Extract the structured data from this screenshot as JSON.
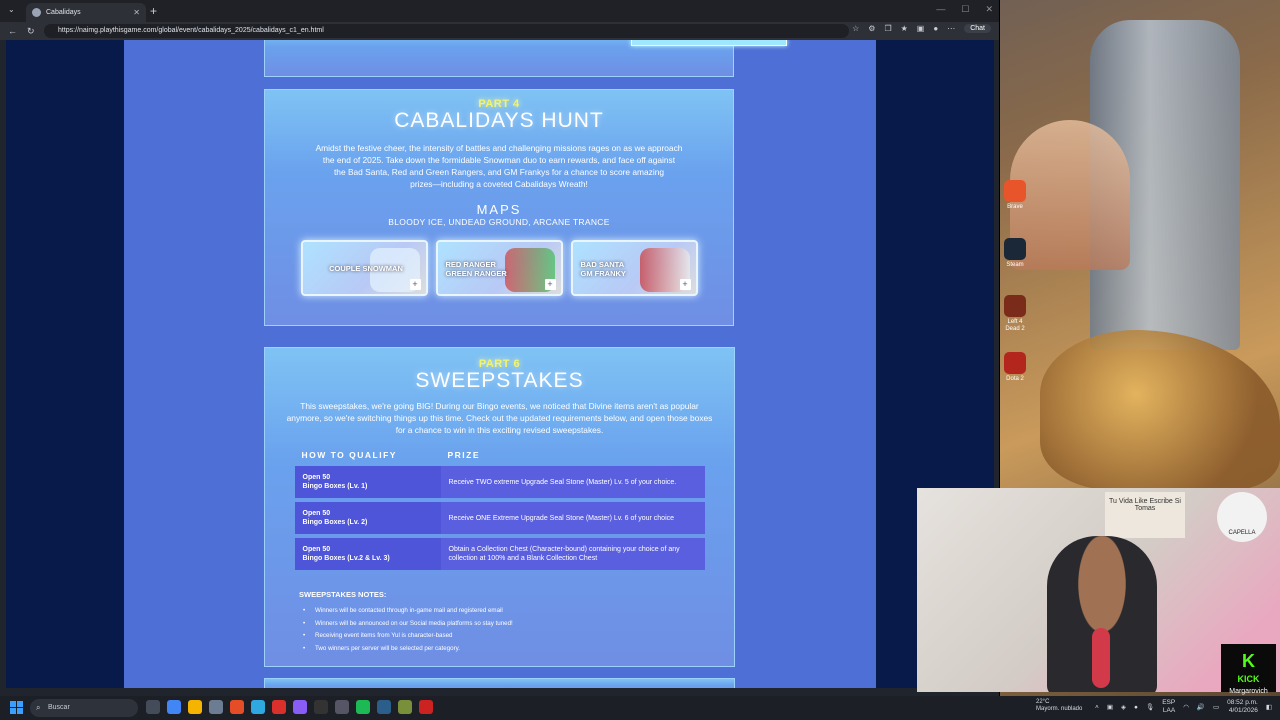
{
  "browser": {
    "tab_title": "Cabalidays",
    "url": "https://naimg.playthisgame.com/global/event/cabalidays_2025/cabalidays_c1_en.html",
    "chat_label": "Chat"
  },
  "part4": {
    "part_label": "PART 4",
    "title": "CABALIDAYS HUNT",
    "description_lines": [
      "Amidst the festive cheer, the intensity of battles and challenging missions rages on as we approach",
      "the end of 2025. Take down the formidable Snowman duo to earn rewards, and face off against",
      "the Bad Santa, Red and Green Rangers, and GM Frankys for a chance to score amazing",
      "prizes—including a coveted Cabalidays Wreath!"
    ],
    "maps_title": "MAPS",
    "maps_list": "BLOODY ICE, UNDEAD GROUND, ARCANE TRANCE",
    "map_cards": [
      {
        "line1": "COUPLE SNOWMAN",
        "line2": "",
        "plus": "+"
      },
      {
        "line1": "RED RANGER",
        "line2": "GREEN RANGER",
        "plus": "+"
      },
      {
        "line1": "BAD SANTA",
        "line2": "GM FRANKY",
        "plus": "+"
      }
    ]
  },
  "part6": {
    "part_label": "PART 6",
    "title": "SWEEPSTAKES",
    "description_lines": [
      "This sweepstakes, we're going BIG! During our Bingo events, we noticed that Divine items aren't as popular",
      "anymore, so we're switching things up this time. Check out the updated requirements below, and open those boxes",
      "for a chance to win in this exciting revised sweepstakes."
    ],
    "headers": {
      "qualify": "HOW TO QUALIFY",
      "prize": "PRIZE"
    },
    "rows": [
      {
        "q1": "Open 50",
        "q2": "Bingo Boxes (Lv. 1)",
        "prize1": "Receive TWO extreme Upgrade Seal Stone (Master) Lv. 5 of your choice.",
        "prize2": ""
      },
      {
        "q1": "Open 50",
        "q2": "Bingo Boxes (Lv. 2)",
        "prize1": "Receive ONE Extreme Upgrade Seal Stone (Master) Lv. 6 of your choice",
        "prize2": ""
      },
      {
        "q1": "Open 50",
        "q2": "Bingo Boxes (Lv.2 & Lv. 3)",
        "prize1": "Obtain a Collection Chest (Character-bound) containing your choice of any",
        "prize2": "collection at 100% and a Blank Collection Chest"
      }
    ],
    "notes_title": "SWEEPSTAKES NOTES:",
    "notes": [
      "Winners will be contacted through in-game mail and registered email",
      "Winners will be announced on our Social media platforms so stay tuned!",
      "Receiving event items from Yul is character-based",
      "Two winners per server will be selected per category."
    ]
  },
  "desktop_icons": [
    {
      "label": "Brave",
      "color": "#e8552b"
    },
    {
      "label": "Steam",
      "color": "#1b2838"
    },
    {
      "label": "Left 4 Dead 2",
      "color": "#7a2b1a"
    },
    {
      "label": "Dota 2",
      "color": "#b3261e"
    }
  ],
  "webcam": {
    "sign_text": "Tu Vida Like Escribe Si Tomas",
    "logo_text": "CAPELLA"
  },
  "kick": {
    "brand": "KICK",
    "user": "Margarovich"
  },
  "taskbar": {
    "search_placeholder": "Buscar",
    "weather_temp": "22°C",
    "weather_desc": "Mayorm. nublado",
    "lang": "ESP",
    "lang2": "LAA",
    "time": "08:52 p.m.",
    "date": "4/01/2026"
  }
}
